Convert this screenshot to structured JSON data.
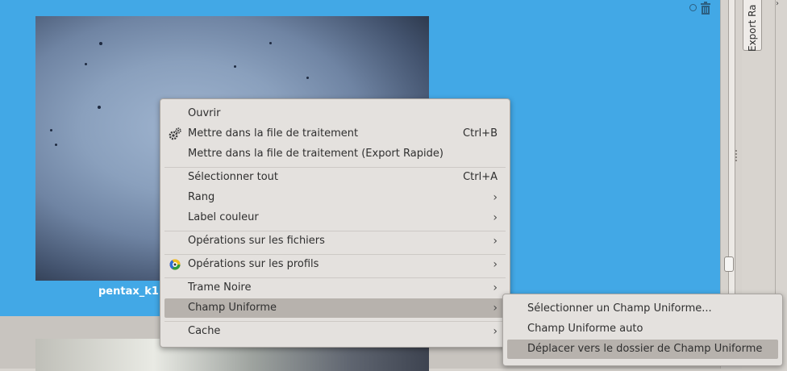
{
  "thumbnail": {
    "caption": "pentax_k1"
  },
  "side_panel": {
    "tab_label": "Export Ra"
  },
  "context_menu": {
    "items": [
      {
        "label": "Ouvrir"
      },
      {
        "label": "Mettre dans la file de traitement",
        "shortcut": "Ctrl+B",
        "icon": "gears-icon"
      },
      {
        "label": "Mettre dans la file de traitement (Export Rapide)"
      },
      {
        "label": "Sélectionner tout",
        "shortcut": "Ctrl+A"
      },
      {
        "label": "Rang",
        "submenu": true
      },
      {
        "label": "Label couleur",
        "submenu": true
      },
      {
        "label": "Opérations sur les fichiers",
        "submenu": true
      },
      {
        "label": "Opérations sur les profils",
        "submenu": true,
        "icon": "color-wheel-icon"
      },
      {
        "label": "Trame Noire",
        "submenu": true
      },
      {
        "label": "Champ Uniforme",
        "submenu": true,
        "highlighted": true
      },
      {
        "label": "Cache",
        "submenu": true
      }
    ],
    "submenu_arrow": "›"
  },
  "flatfield_submenu": {
    "items": [
      {
        "label": "Sélectionner un Champ Uniforme..."
      },
      {
        "label": "Champ Uniforme auto"
      },
      {
        "label": "Déplacer vers le dossier de Champ Uniforme",
        "highlighted": true
      }
    ]
  },
  "colors": {
    "browser_background": "#42a8e6",
    "menu_background": "#e4e1de",
    "highlight": "#b7b2ad"
  }
}
